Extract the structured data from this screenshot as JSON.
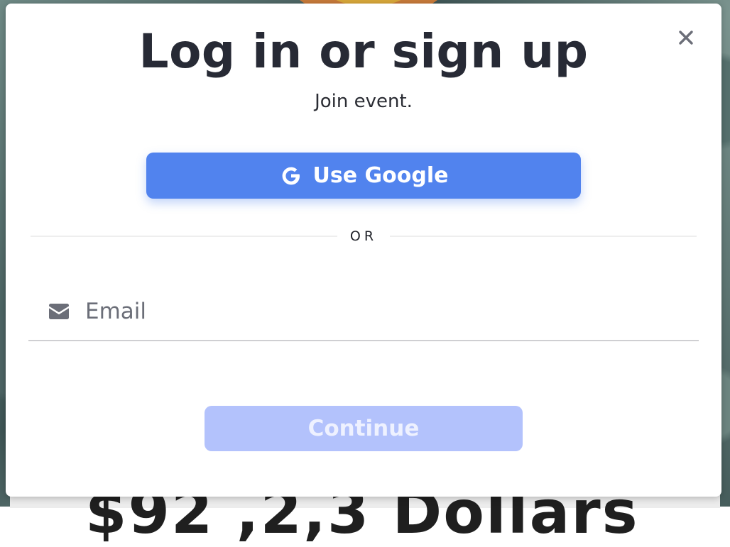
{
  "background": {
    "partial_heading": "$92 ,2,3 Dollars"
  },
  "modal": {
    "title": "Log in or sign up",
    "subtitle": "Join event.",
    "close_icon": "close-icon",
    "google_button": {
      "label": "Use Google",
      "icon": "google-g-icon",
      "color": "#5183ee"
    },
    "divider_text": "OR",
    "email_field": {
      "icon": "envelope-icon",
      "placeholder": "Email",
      "value": ""
    },
    "continue_button": {
      "label": "Continue",
      "state": "disabled",
      "color": "#b3c2fc"
    }
  }
}
